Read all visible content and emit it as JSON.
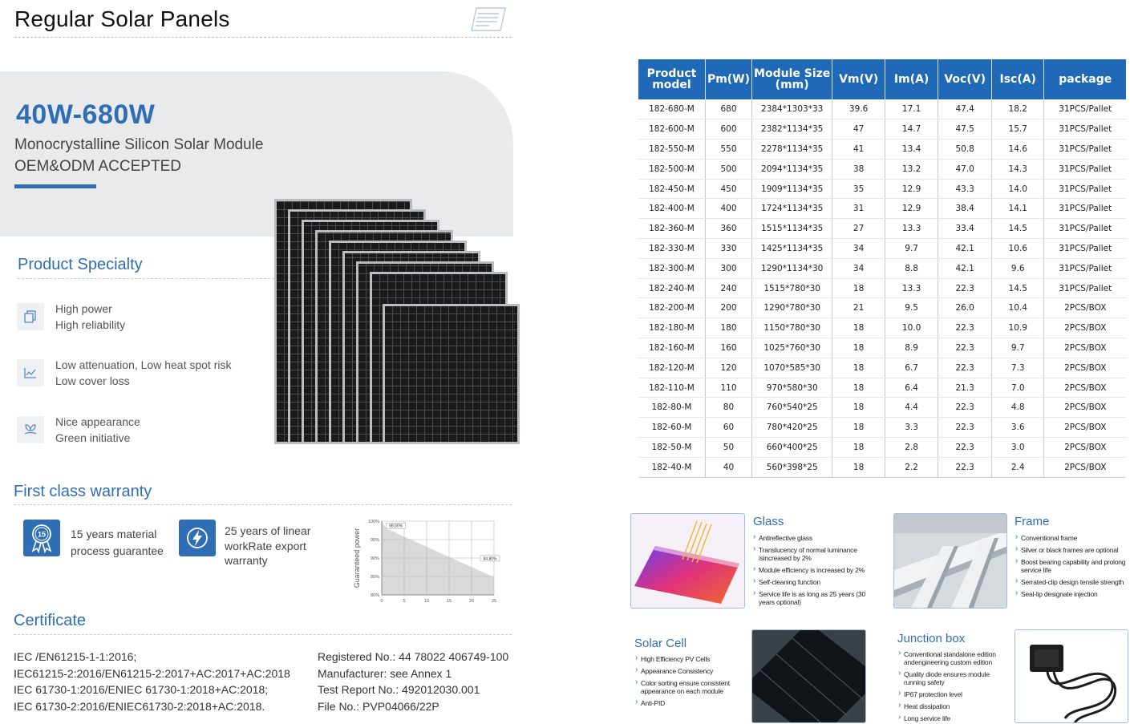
{
  "header": {
    "title": "Regular Solar Panels"
  },
  "hero": {
    "range": "40W-680W",
    "subtitle": "Monocrystalline Silicon Solar Module",
    "subtitle2": "OEM&ODM ACCEPTED"
  },
  "specialty": {
    "heading": "Product Specialty",
    "items": [
      {
        "icon": "copy-icon",
        "line1": "High  power",
        "line2": "High  reliability"
      },
      {
        "icon": "chart-icon",
        "line1": "Low attenuation, Low heat spot risk",
        "line2": "Low cover loss"
      },
      {
        "icon": "eco-icon",
        "line1": "Nice  appearance",
        "line2": "Green  initiative"
      }
    ]
  },
  "warranty": {
    "heading": "First class warranty",
    "badge_number": "15",
    "item1": {
      "line1": "15 years material",
      "line2": "process guarantee"
    },
    "item2": {
      "line1": "25 years of linear",
      "line2": "workRate export",
      "line3": "warranty"
    }
  },
  "chart_data": {
    "type": "area",
    "ylabel": "Guaranteed power",
    "x_ticks": [
      "0",
      "5",
      "10",
      "15",
      "20",
      "25"
    ],
    "y_ticks": [
      "100%",
      "95%",
      "90%",
      "85%",
      "80%"
    ],
    "xlim": [
      0,
      25
    ],
    "ylim": [
      80,
      100
    ],
    "series": [
      {
        "x": [
          0,
          1,
          25
        ],
        "values": [
          100,
          98.0,
          84.8
        ]
      }
    ],
    "annotations": [
      "98.00%",
      "84.80%"
    ],
    "grid": true
  },
  "certificate": {
    "heading": "Certificate",
    "left": [
      "IEC /EN61215-1-1:2016;",
      "IEC61215-2:2016/EN61215-2:2017+AC:2017+AC:2018",
      "IEC 61730-1:2016/ENIEC 61730-1:2018+AC:2018;",
      "IEC 61730-2:2016/ENIEC61730-2:2018+AC:2018."
    ],
    "right": [
      "Registered No.: 44 78022 406749-100",
      "Manufacturer: see Annex 1",
      "Test Report No.: 492012030.001",
      "File No.: PVP04066/22P"
    ]
  },
  "table": {
    "headers": [
      "Product model",
      "Pm(W)",
      "Module Size (mm)",
      "Vm(V)",
      "Im(A)",
      "Voc(V)",
      "Isc(A)",
      "package"
    ],
    "rows": [
      [
        "182-680-M",
        "680",
        "2384*1303*33",
        "39.6",
        "17.1",
        "47.4",
        "18.2",
        "31PCS/Pallet"
      ],
      [
        "182-600-M",
        "600",
        "2382*1134*35",
        "47",
        "14.7",
        "47.5",
        "15.7",
        "31PCS/Pallet"
      ],
      [
        "182-550-M",
        "550",
        "2278*1134*35",
        "41",
        "13.4",
        "50.8",
        "14.6",
        "31PCS/Pallet"
      ],
      [
        "182-500-M",
        "500",
        "2094*1134*35",
        "38",
        "13.2",
        "47.0",
        "14.3",
        "31PCS/Pallet"
      ],
      [
        "182-450-M",
        "450",
        "1909*1134*35",
        "35",
        "12.9",
        "43.3",
        "14.0",
        "31PCS/Pallet"
      ],
      [
        "182-400-M",
        "400",
        "1724*1134*35",
        "31",
        "12.9",
        "38.4",
        "14.1",
        "31PCS/Pallet"
      ],
      [
        "182-360-M",
        "360",
        "1515*1134*35",
        "27",
        "13.3",
        "33.4",
        "14.5",
        "31PCS/Pallet"
      ],
      [
        "182-330-M",
        "330",
        "1425*1134*35",
        "34",
        "9.7",
        "42.1",
        "10.6",
        "31PCS/Pallet"
      ],
      [
        "182-300-M",
        "300",
        "1290*1134*30",
        "34",
        "8.8",
        "42.1",
        "9.6",
        "31PCS/Pallet"
      ],
      [
        "182-240-M",
        "240",
        "1515*780*30",
        "18",
        "13.3",
        "22.3",
        "14.5",
        "31PCS/Pallet"
      ],
      [
        "182-200-M",
        "200",
        "1290*780*30",
        "21",
        "9.5",
        "26.0",
        "10.4",
        "2PCS/BOX"
      ],
      [
        "182-180-M",
        "180",
        "1150*780*30",
        "18",
        "10.0",
        "22.3",
        "10.9",
        "2PCS/BOX"
      ],
      [
        "182-160-M",
        "160",
        "1025*760*30",
        "18",
        "8.9",
        "22.3",
        "9.7",
        "2PCS/BOX"
      ],
      [
        "182-120-M",
        "120",
        "1070*585*30",
        "18",
        "6.7",
        "22.3",
        "7.3",
        "2PCS/BOX"
      ],
      [
        "182-110-M",
        "110",
        "970*580*30",
        "18",
        "6.4",
        "21.3",
        "7.0",
        "2PCS/BOX"
      ],
      [
        "182-80-M",
        "80",
        "760*540*25",
        "18",
        "4.4",
        "22.3",
        "4.8",
        "2PCS/BOX"
      ],
      [
        "182-60-M",
        "60",
        "780*420*25",
        "18",
        "3.3",
        "22.3",
        "3.6",
        "2PCS/BOX"
      ],
      [
        "182-50-M",
        "50",
        "660*400*25",
        "18",
        "2.8",
        "22.3",
        "3.0",
        "2PCS/BOX"
      ],
      [
        "182-40-M",
        "40",
        "560*398*25",
        "18",
        "2.2",
        "22.3",
        "2.4",
        "2PCS/BOX"
      ]
    ]
  },
  "features": {
    "glass": {
      "title": "Glass",
      "items": [
        "Antireflective glass",
        "Translucency of normal luminance isincreased by 2%",
        "Module efficiency is increased by 2%",
        "Self-cleaning function",
        "Service life is as long as 25 years (30 years optional)"
      ]
    },
    "frame": {
      "title": "Frame",
      "items": [
        "Conventional frame",
        "Silver or black frames are optional",
        "Boost bearing capability and prolong service life",
        "Serrated-clip design tensile strength",
        "Seal-lip designate injection"
      ]
    },
    "cell": {
      "title": "Solar Cell",
      "items": [
        "High Efficiency PV Cells",
        "Appearance Consistency",
        "Color sorting ensure consistent appearance on each module",
        "Anti-PID"
      ]
    },
    "junction": {
      "title": "Junction box",
      "items": [
        "Conventional standalone edition andengineering custom edition",
        "Quality diode ensures module running safety",
        "IP67 protection level",
        "Heat dissipation",
        "Long service life"
      ]
    }
  },
  "colors": {
    "accent": "#2f6eb5",
    "table_header": "#1f69b6",
    "hero_bg": "#e9eaec"
  }
}
